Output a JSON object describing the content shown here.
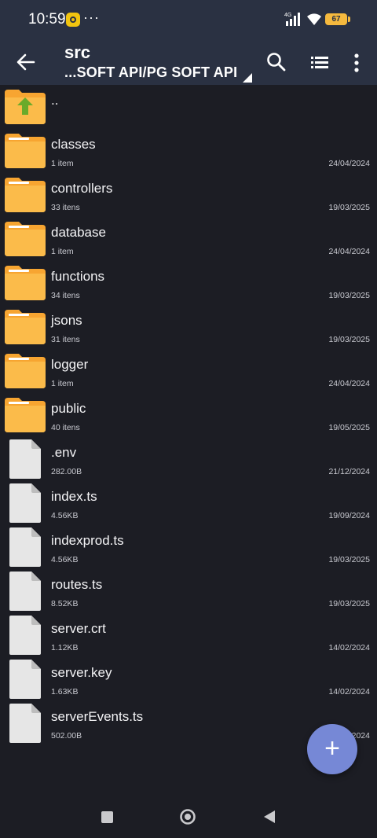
{
  "status_bar": {
    "time": "10:59",
    "overflow": "···",
    "network": "4G",
    "battery": "67"
  },
  "app_bar": {
    "title": "src",
    "path": "...SOFT API/PG SOFT API"
  },
  "parent_entry": {
    "name": ".."
  },
  "entries": [
    {
      "type": "folder",
      "name": "classes",
      "meta": "1 item",
      "date": "24/04/2024"
    },
    {
      "type": "folder",
      "name": "controllers",
      "meta": "33 itens",
      "date": "19/03/2025"
    },
    {
      "type": "folder",
      "name": "database",
      "meta": "1 item",
      "date": "24/04/2024"
    },
    {
      "type": "folder",
      "name": "functions",
      "meta": "34 itens",
      "date": "19/03/2025"
    },
    {
      "type": "folder",
      "name": "jsons",
      "meta": "31 itens",
      "date": "19/03/2025"
    },
    {
      "type": "folder",
      "name": "logger",
      "meta": "1 item",
      "date": "24/04/2024"
    },
    {
      "type": "folder",
      "name": "public",
      "meta": "40 itens",
      "date": "19/05/2025"
    },
    {
      "type": "file",
      "name": ".env",
      "meta": "282.00B",
      "date": "21/12/2024"
    },
    {
      "type": "file",
      "name": "index.ts",
      "meta": "4.56KB",
      "date": "19/09/2024"
    },
    {
      "type": "file",
      "name": "indexprod.ts",
      "meta": "4.56KB",
      "date": "19/03/2025"
    },
    {
      "type": "file",
      "name": "routes.ts",
      "meta": "8.52KB",
      "date": "19/03/2025"
    },
    {
      "type": "file",
      "name": "server.crt",
      "meta": "1.12KB",
      "date": "14/02/2024"
    },
    {
      "type": "file",
      "name": "server.key",
      "meta": "1.63KB",
      "date": "14/02/2024"
    },
    {
      "type": "file",
      "name": "serverEvents.ts",
      "meta": "502.00B",
      "date": "2024"
    }
  ],
  "fab": {
    "label": "+"
  },
  "colors": {
    "background": "#1c1d24",
    "appbar": "#2a3142",
    "folder": "#f7a531",
    "folder_light": "#fbbb4a",
    "up_arrow": "#6aaa2a",
    "file": "#e6e6e6",
    "fab": "#7688d6"
  },
  "icons": {
    "back": "arrow-left-icon",
    "search": "search-icon",
    "view": "list-view-icon",
    "more": "more-vert-icon"
  }
}
